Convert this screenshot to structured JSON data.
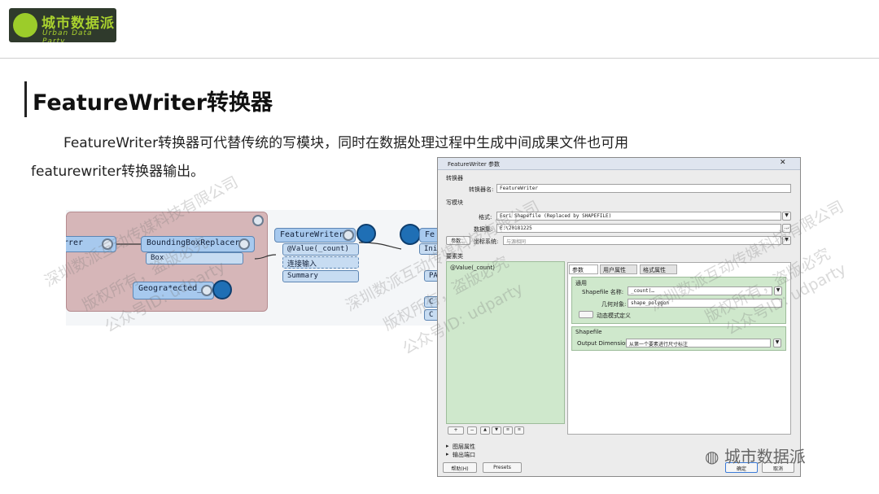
{
  "brand": {
    "name": "城市数据派",
    "sub": "Urban Data Party"
  },
  "page": {
    "title": "FeatureWriter转换器",
    "para_line1": "FeatureWriter转换器可代替传统的写模块，同时在数据处理过程中生成中间成果文件也可用",
    "para_line2": "featurewriter转换器输出。"
  },
  "watermark": {
    "line1": "深圳数派互动传媒科技有限公司",
    "line2": "版权所有，盗版必究",
    "line3": "公众号ID: udparty"
  },
  "workspace": {
    "node_left": "rrer",
    "node_bbr": "BoundingBoxReplacer",
    "port_box": "Box",
    "node_geo": "Geogra*ected_",
    "node_fw": "FeatureWriter",
    "port_value": "@Value(_count)",
    "port_connect": "连接输入",
    "port_summary": "Summary",
    "node_fe": "Fe",
    "port_initiator": "Init",
    "port_pa": "PA",
    "port_c1": "C",
    "port_c2": "C"
  },
  "dialog": {
    "title": "FeatureWriter 参数",
    "section_transformer": "转换器",
    "label_transformer_name": "转换器名:",
    "value_transformer_name": "FeatureWriter",
    "section_writer": "写模块",
    "label_format": "格式:",
    "value_format": "Esri Shapefile (Replaced by SHAPEFILE)",
    "label_dataset": "数据集:",
    "value_dataset": "E:\\20181225",
    "params_button": "参数...",
    "label_coordsys": "坐标系统:",
    "value_coordsys": "与源相同",
    "section_tables": "要素类",
    "table_item": "@Value(_count)",
    "tabs": [
      "参数",
      "用户属性",
      "格式属性"
    ],
    "group_general": "通用",
    "label_shapefile_name": "Shapefile 名称:",
    "value_shapefile_name": "_count(…",
    "label_geometry": "几何对象:",
    "value_geometry": "shape_polygon",
    "label_dynamic": "动态模式定义",
    "group_shapefile": "Shapefile",
    "label_output_dim": "Output Dimension:",
    "value_output_dim": "从第一个要素进行尺寸标注",
    "list_buttons": [
      "+",
      "−",
      "▲",
      "▼",
      "≡",
      "≡"
    ],
    "collapse_attrs": "图层属性",
    "collapse_ports": "输出端口",
    "help_button": "帮助(H)",
    "presets_button": "Presets",
    "ok_button": "确定",
    "cancel_button": "取消"
  },
  "footer": {
    "wechat_label": "城市数据派"
  }
}
